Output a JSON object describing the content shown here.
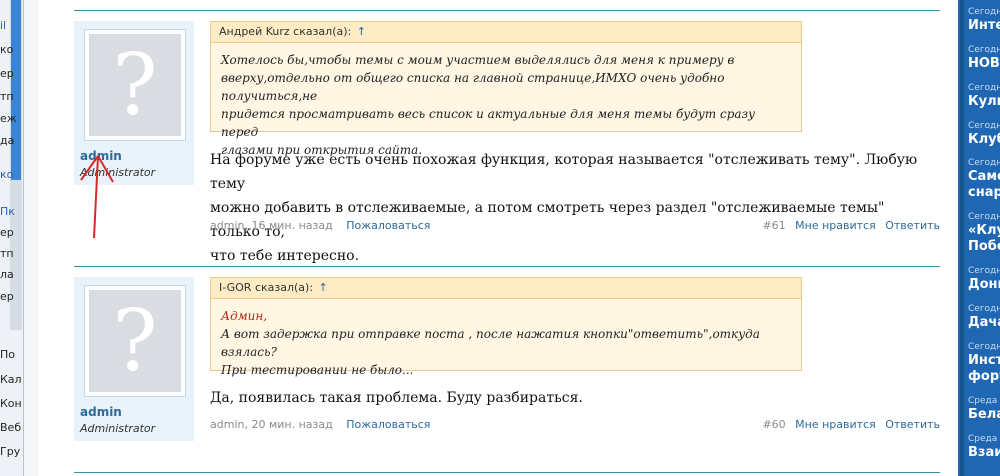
{
  "left_window": {
    "labels": [
      "il",
      "ко",
      "ер",
      "тп",
      "еж",
      "да",
      "ко",
      "Пк",
      "ер",
      "тп",
      "ла",
      "ер",
      "По",
      "Кал",
      "Кон",
      "Веб",
      "Гру"
    ]
  },
  "posts": [
    {
      "author": "admin",
      "role": "Administrator",
      "quote_header": "Андрей Kurz сказал(а):",
      "quote_arrow": "↑",
      "quote_lines": [
        "Хотелось бы,чтобы темы с моим участием выделялись для меня к примеру в",
        "вверху,отдельно от общего списка на главной странице,ИМХО очень удобно получиться,не",
        "придется просматривать весь список и актуальные для меня темы будут сразу перед",
        "глазами при открытия сайта."
      ],
      "text_lines": [
        "На форуме уже есть очень похожая функция, которая называется \"отслеживать тему\". Любую тему",
        "можно добавить в отслеживаемые, а потом смотреть через раздел \"отслеживаемые темы\" только то,",
        "что тебе интересно."
      ],
      "meta": "admin, 16 мин. назад",
      "report": "Пожаловаться",
      "number": "#61",
      "dislike": "Мне нравится",
      "reply": "Ответить"
    },
    {
      "author": "admin",
      "role": "Administrator",
      "quote_header": "I-GOR сказал(а):",
      "quote_arrow": "↑",
      "quote_lines": [
        "Админ,",
        "А вот задержка при отправке поста , после нажатия кнопки\"ответить\",откуда взялась?",
        "При тестировании не было..."
      ],
      "text_lines": [
        "Да, появилась такая проблема. Буду разбираться."
      ],
      "meta": "admin, 20 мин. назад",
      "report": "Пожаловаться",
      "number": "#60",
      "dislike": "Мне нравится",
      "reply": "Ответить"
    }
  ],
  "sidebar": {
    "items": [
      {
        "day": "Сегодн",
        "title": "Инте"
      },
      {
        "day": "Сегодн",
        "title": "НОВО"
      },
      {
        "day": "Сегодн",
        "title": "Кули"
      },
      {
        "day": "Сегодн",
        "title": "Клуб"
      },
      {
        "day": "Сегодн",
        "title": "Само",
        "title2": "снар"
      },
      {
        "day": "Сегодн",
        "title": "«Клу",
        "title2": "Побе"
      },
      {
        "day": "Сегодн",
        "title": "Донк"
      },
      {
        "day": "Сегодн",
        "title": "Дача"
      },
      {
        "day": "Сегодн",
        "title": "Инст",
        "title2": "фору"
      },
      {
        "day": "Среда",
        "title": "Бела"
      },
      {
        "day": "Среда",
        "title": "Взаи"
      }
    ]
  },
  "colors": {
    "sidebar_bg": "#1f67b3",
    "link": "#2b6b9c",
    "quote_bg": "#fff7e3",
    "annotation": "#d42a2a"
  },
  "annotation_icon": "red-arrow-icon"
}
